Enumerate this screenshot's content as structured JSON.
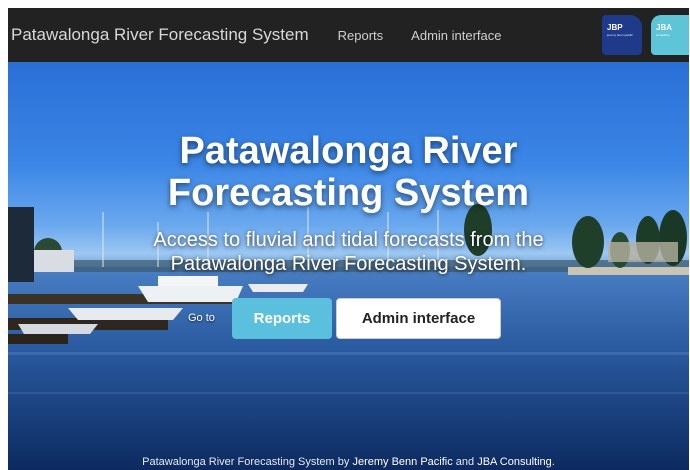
{
  "navbar": {
    "brand": "Patawalonga River Forecasting System",
    "links": [
      "Reports",
      "Admin interface"
    ],
    "logos": [
      {
        "mark": "JBP",
        "tiny": "jeremy benn pacific"
      },
      {
        "mark": "JBA",
        "tiny": "consulting"
      }
    ]
  },
  "hero": {
    "title_line1": "Patawalonga River",
    "title_line2": "Forecasting System",
    "subtitle_line1": "Access to fluvial and tidal forecasts from the",
    "subtitle_line2": "Patawalonga River Forecasting System.",
    "goto_label": "Go to",
    "reports_button": "Reports",
    "admin_button": "Admin interface"
  },
  "footer": {
    "prefix": "Patawalonga River Forecasting System by ",
    "link1": "Jeremy Benn Pacific",
    "and": " and ",
    "link2": "JBA Consulting",
    "suffix": "."
  }
}
